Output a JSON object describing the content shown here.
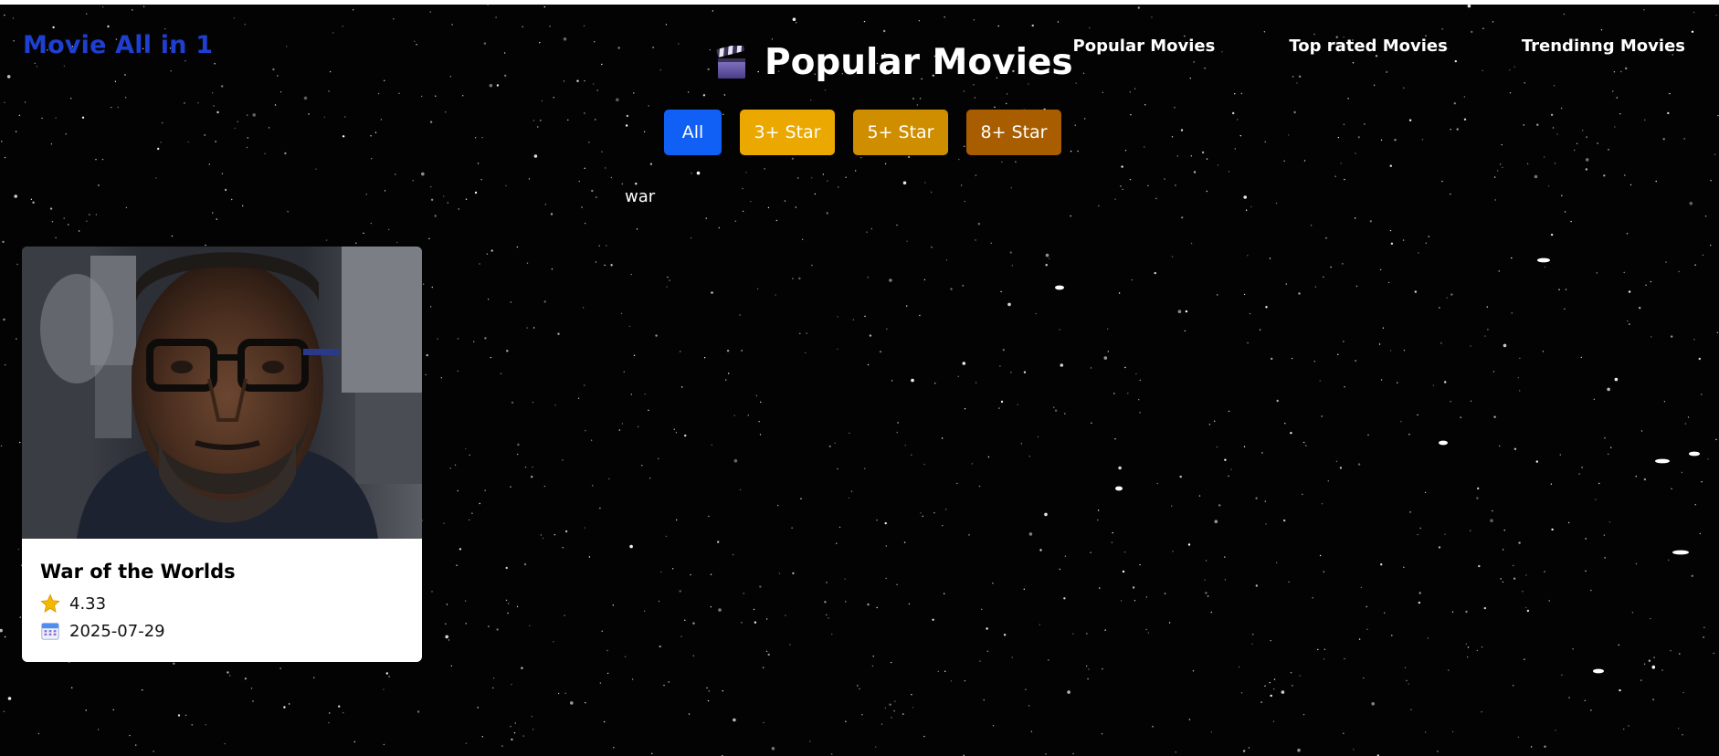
{
  "brand": {
    "name": "Movie All in 1",
    "color": "#1f3fd0"
  },
  "nav": {
    "items": [
      {
        "label": "Popular Movies"
      },
      {
        "label": "Top rated Movies"
      },
      {
        "label": "Trendinng Movies"
      }
    ]
  },
  "heading": {
    "icon": "clapperboard-icon",
    "title": "Popular Movies"
  },
  "filters": {
    "items": [
      {
        "label": "All",
        "color": "#1060f5"
      },
      {
        "label": "3+ Star",
        "color": "#eaa800"
      },
      {
        "label": "5+ Star",
        "color": "#cf8d00"
      },
      {
        "label": "8+ Star",
        "color": "#a85e00"
      }
    ]
  },
  "search": {
    "value": "war"
  },
  "movies": [
    {
      "title": "War of the Worlds",
      "rating": "4.33",
      "rating_icon": "star-icon",
      "release_date": "2025-07-29",
      "date_icon": "calendar-icon"
    }
  ]
}
